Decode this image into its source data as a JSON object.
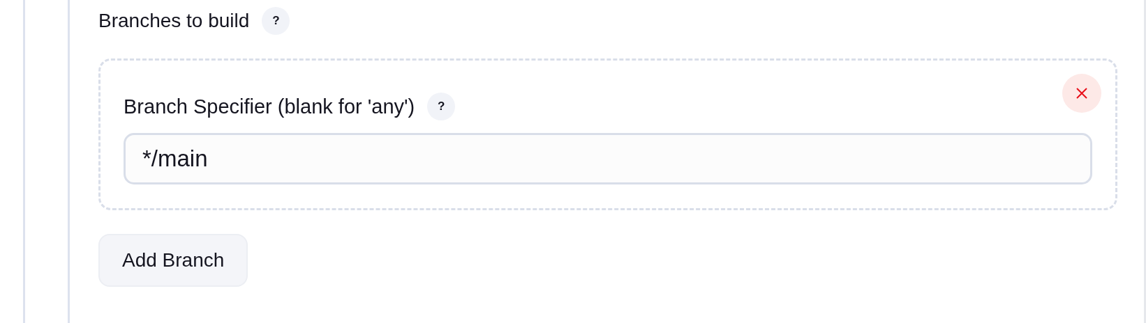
{
  "section": {
    "title": "Branches to build",
    "help": "?"
  },
  "branches": [
    {
      "label": "Branch Specifier (blank for 'any')",
      "help": "?",
      "value": "*/main"
    }
  ],
  "add_button": "Add Branch"
}
